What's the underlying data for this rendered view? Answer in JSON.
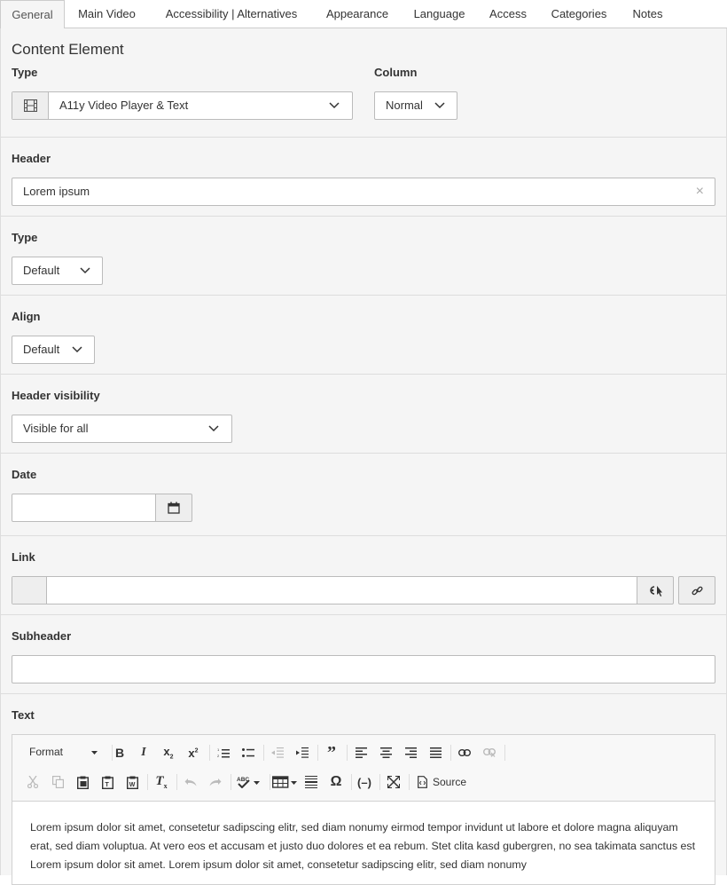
{
  "tabs": [
    {
      "label": "General",
      "active": true
    },
    {
      "label": "Main Video"
    },
    {
      "label": "Accessibility | Alternatives"
    },
    {
      "label": "Appearance"
    },
    {
      "label": "Language"
    },
    {
      "label": "Access"
    },
    {
      "label": "Categories"
    },
    {
      "label": "Notes"
    }
  ],
  "content_element": {
    "title": "Content Element",
    "type_label": "Type",
    "type_value": "A11y Video Player & Text",
    "type_icon": "film-icon",
    "column_label": "Column",
    "column_value": "Normal"
  },
  "header": {
    "label": "Header",
    "value": "Lorem ipsum",
    "clear_glyph": "×"
  },
  "header_type": {
    "label": "Type",
    "value": "Default"
  },
  "align": {
    "label": "Align",
    "value": "Default"
  },
  "header_visibility": {
    "label": "Header visibility",
    "value": "Visible for all"
  },
  "date": {
    "label": "Date",
    "value": "",
    "icon": "calendar-icon"
  },
  "link": {
    "label": "Link",
    "value": "",
    "icons": [
      "link-browser-icon",
      "link-icon"
    ]
  },
  "subheader": {
    "label": "Subheader",
    "value": ""
  },
  "text": {
    "label": "Text",
    "toolbar": {
      "format_label": "Format",
      "source_label": "Source"
    },
    "content": "Lorem ipsum dolor sit amet, consetetur sadipscing elitr, sed diam nonumy eirmod tempor invidunt ut labore et dolore magna aliquyam erat, sed diam voluptua. At vero eos et accusam et justo duo dolores et ea rebum. Stet clita kasd gubergren, no sea takimata sanctus est Lorem ipsum dolor sit amet. Lorem ipsum dolor sit amet, consetetur sadipscing elitr, sed diam nonumy"
  },
  "colors": {
    "panel_bg": "#f5f5f5",
    "border": "#bbbbbb",
    "toolbar_bg": "#f8f8f8"
  }
}
